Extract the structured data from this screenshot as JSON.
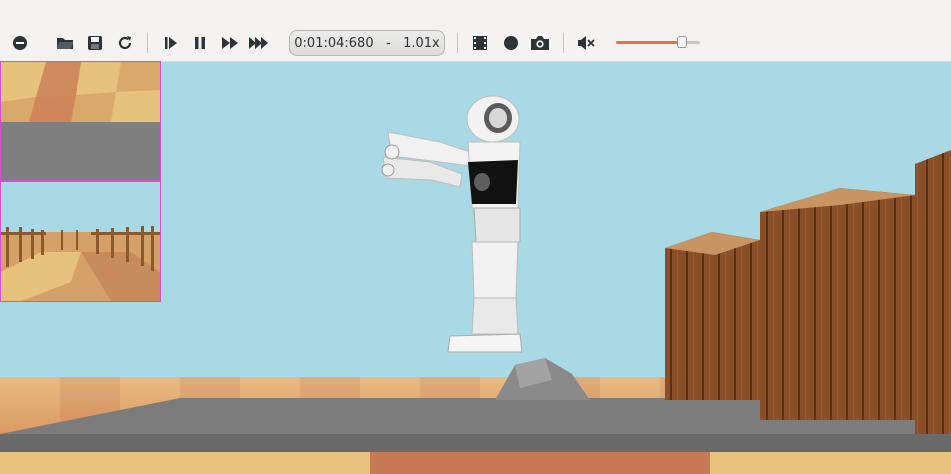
{
  "toolbar": {
    "time_display": "0:01:04:680   -   1.01x",
    "volume_level": 0.78,
    "icons": [
      "remove-icon",
      "open-folder-icon",
      "save-icon",
      "reload-icon",
      "step-icon",
      "pause-icon",
      "run-icon",
      "fast-forward-icon",
      "record-movie-icon",
      "record-icon",
      "screenshot-icon",
      "mute-icon"
    ]
  },
  "colors": {
    "accent": "#e9733f",
    "sky": "#a9d9e5",
    "overlay_border": "#d24fd0"
  }
}
